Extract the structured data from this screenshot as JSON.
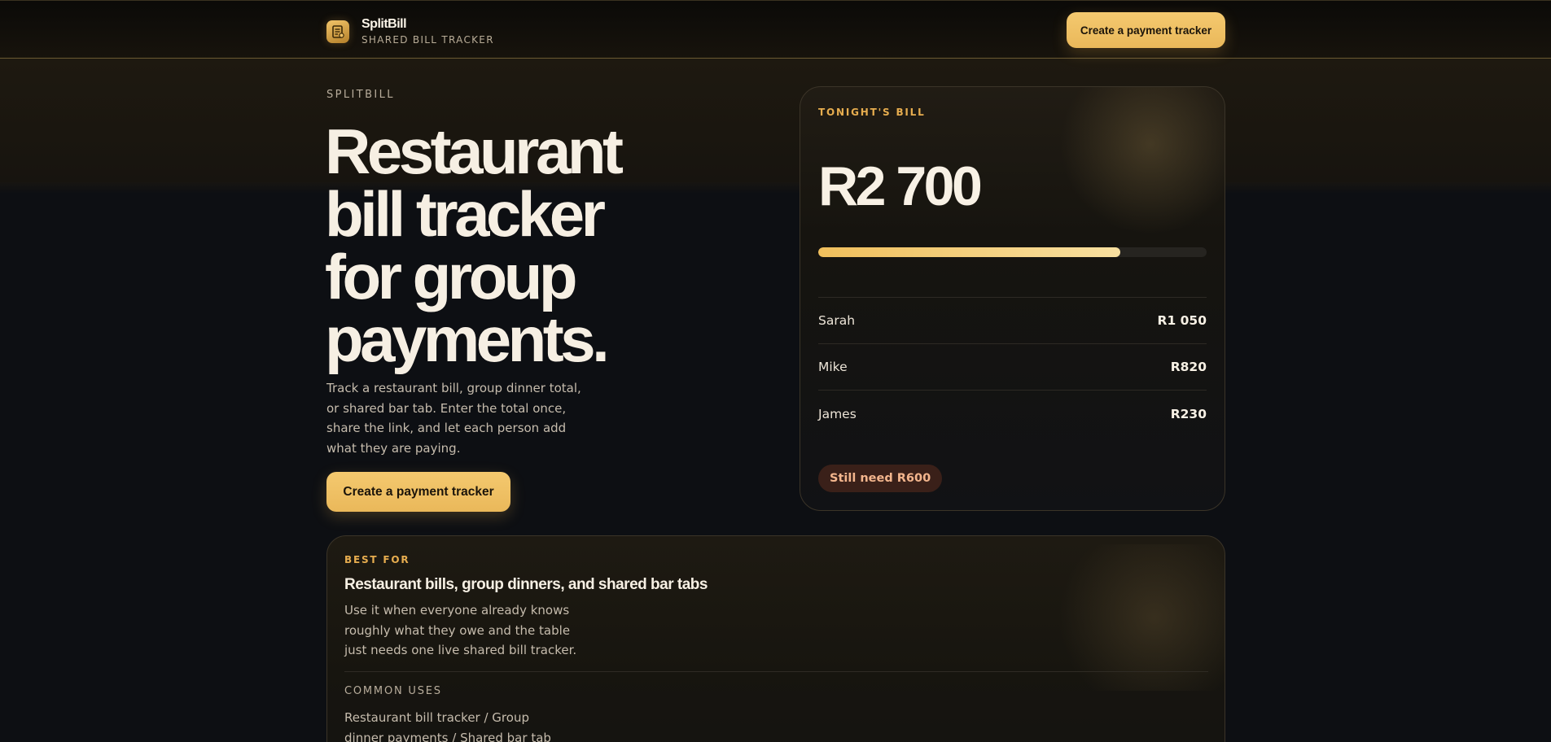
{
  "header": {
    "brand_name": "SplitBill",
    "brand_sub": "SHARED BILL TRACKER",
    "cta_label": "Create a payment tracker"
  },
  "hero": {
    "eyebrow": "SPLITBILL",
    "headline": "Restaurant bill tracker for group payments.",
    "lede": "Track a restaurant bill, group dinner total, or shared bar tab. Enter the total once, share the link, and let each person add what they are paying.",
    "cta_label": "Create a payment tracker"
  },
  "bill_card": {
    "eyebrow": "TONIGHT'S BILL",
    "total": "R2 700",
    "progress_fraction": 0.778,
    "payers": [
      {
        "name": "Sarah",
        "amount": "R1 050"
      },
      {
        "name": "Mike",
        "amount": "R820"
      },
      {
        "name": "James",
        "amount": "R230"
      }
    ],
    "remaining_badge": "Still need R600"
  },
  "best_for": {
    "eyebrow": "BEST FOR",
    "title": "Restaurant bills, group dinners, and shared bar tabs",
    "description": "Use it when everyone already knows roughly what they owe and the table just needs one live shared bill tracker.",
    "uses_eyebrow": "COMMON USES",
    "uses_text": "Restaurant bill tracker / Group dinner payments / Shared bar tab"
  },
  "colors": {
    "accent": "#f0bf5c",
    "eyebrow_accent": "#e7ad4f",
    "background": "#0d0f13",
    "badge_bg": "#3a2019",
    "badge_text": "#f3b58d"
  },
  "icons": {
    "brand": "receipt-icon"
  }
}
